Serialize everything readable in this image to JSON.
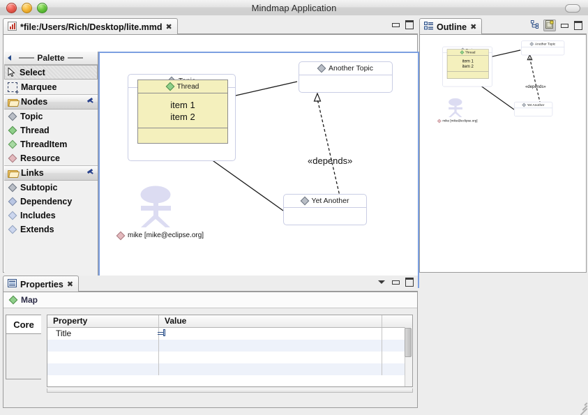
{
  "window": {
    "title": "Mindmap Application",
    "controls": [
      "close",
      "minimize",
      "zoom"
    ]
  },
  "editor": {
    "tab_label": "*file:/Users/Rich/Desktop/lite.mmd",
    "tab_close": "✖",
    "buttons": [
      {
        "name": "minimize",
        "icon": "minimize-icon"
      },
      {
        "name": "maximize",
        "icon": "maximize-icon"
      }
    ]
  },
  "palette": {
    "title": "Palette",
    "collapse_icon": "collapse-arrow-icon",
    "tools": [
      {
        "label": "Select",
        "icon": "cursor-icon",
        "selected": true
      },
      {
        "label": "Marquee",
        "icon": "marquee-icon",
        "selected": false
      }
    ],
    "drawers": [
      {
        "label": "Nodes",
        "icon": "folder-icon",
        "pin": "pin-icon",
        "items": [
          {
            "label": "Topic",
            "icon": "diamond-icon",
            "color": "gray"
          },
          {
            "label": "Thread",
            "icon": "diamond-icon",
            "color": "green"
          },
          {
            "label": "ThreadItem",
            "icon": "diamond-icon",
            "color": "green2"
          },
          {
            "label": "Resource",
            "icon": "diamond-icon",
            "color": "pink"
          }
        ]
      },
      {
        "label": "Links",
        "icon": "folder-icon",
        "pin": "pin-icon",
        "items": [
          {
            "label": "Subtopic",
            "icon": "diamond-icon",
            "color": "gray"
          },
          {
            "label": "Dependency",
            "icon": "diamond-icon",
            "color": "blue"
          },
          {
            "label": "Includes",
            "icon": "diamond-icon",
            "color": "blue2"
          },
          {
            "label": "Extends",
            "icon": "diamond-icon",
            "color": "blue2"
          }
        ]
      }
    ]
  },
  "diagram": {
    "nodes": {
      "topic": {
        "title": "Topic"
      },
      "thread": {
        "title": "Thread",
        "items": [
          "item 1",
          "item 2"
        ]
      },
      "another_topic": {
        "title": "Another Topic"
      },
      "yet_another": {
        "title": "Yet Another"
      }
    },
    "edge_label": "«depends»",
    "actor": {
      "label": "mike [mike@eclipse.org]",
      "icon": "actor-figure"
    }
  },
  "outline": {
    "tab_label": "Outline",
    "tab_close": "✖",
    "tab_icon": "outline-icon",
    "buttons": [
      {
        "name": "tree-view",
        "icon": "tree-icon",
        "pressed": false
      },
      {
        "name": "thumbnail-view",
        "icon": "thumbnail-icon",
        "pressed": true
      },
      {
        "name": "minimize",
        "icon": "minimize-icon",
        "pressed": false
      },
      {
        "name": "maximize",
        "icon": "maximize-icon",
        "pressed": false
      }
    ]
  },
  "properties": {
    "tab_label": "Properties",
    "tab_close": "✖",
    "tab_icon": "properties-icon",
    "buttons": [
      {
        "name": "view-menu",
        "icon": "chevron-down-icon"
      },
      {
        "name": "minimize",
        "icon": "minimize-icon"
      },
      {
        "name": "maximize",
        "icon": "maximize-icon"
      }
    ],
    "selection": {
      "label": "Map",
      "icon": "diamond-icon"
    },
    "side_tabs": [
      {
        "label": "Core",
        "selected": true
      }
    ],
    "table": {
      "columns": [
        "Property",
        "Value"
      ],
      "rows": [
        {
          "property": "Title",
          "value": "",
          "value_icon": "list-edit-icon"
        },
        {
          "property": "",
          "value": ""
        },
        {
          "property": "",
          "value": ""
        },
        {
          "property": "",
          "value": ""
        }
      ]
    }
  }
}
